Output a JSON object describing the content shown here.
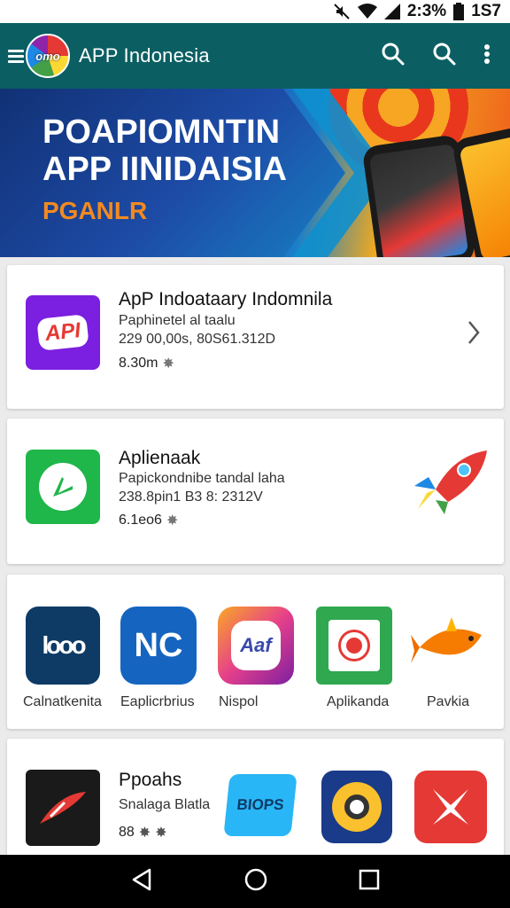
{
  "status_bar": {
    "time_text": "2:3%",
    "extra_text": "1S7"
  },
  "app_bar": {
    "logo_text": "omo",
    "title": "APP Indonesia",
    "icons": [
      "menu-icon",
      "search-icon",
      "search-icon",
      "more-vert-icon"
    ]
  },
  "banner": {
    "line1": "POAPIOMNTIN",
    "line2": "APP IINIDAISIA",
    "subtitle": "PGANLR"
  },
  "featured": [
    {
      "icon_text": "API",
      "icon_color": "#7b1fe0",
      "title": "ApP Indoataary Indomnila",
      "subtitle": "Paphinetel al taalu",
      "meta": "229 00,00s, 80S61.312D",
      "rating": "8.30m"
    },
    {
      "icon_color": "#1fb64a",
      "title": "Aplienaak",
      "subtitle": "Papickondnibe tandal laha",
      "meta": "238.8pin1 B3 8: 2312V",
      "rating": "6.1eo6"
    }
  ],
  "app_grid": [
    {
      "icon_text": "looo",
      "label": "Calnatkenita",
      "color": "#0d3b66"
    },
    {
      "icon_text": "NC",
      "label": "Eaplicrbrius",
      "color": "#1565c0"
    },
    {
      "icon_text": "Aaf",
      "label": "Nispol",
      "color": "#e6408a"
    },
    {
      "icon_text": "",
      "label": "Aplikanda",
      "color": "#2fa84f"
    },
    {
      "icon_text": "",
      "label": "Pavkia",
      "color": "#ffffff"
    }
  ],
  "bottom_card": {
    "title": "Ppoahs",
    "subtitle": "Snalaga Blatla",
    "rating": "88",
    "tile2_text": "BIOPS"
  },
  "nav_bar": {
    "icons": [
      "back-icon",
      "home-icon",
      "recents-icon"
    ]
  }
}
